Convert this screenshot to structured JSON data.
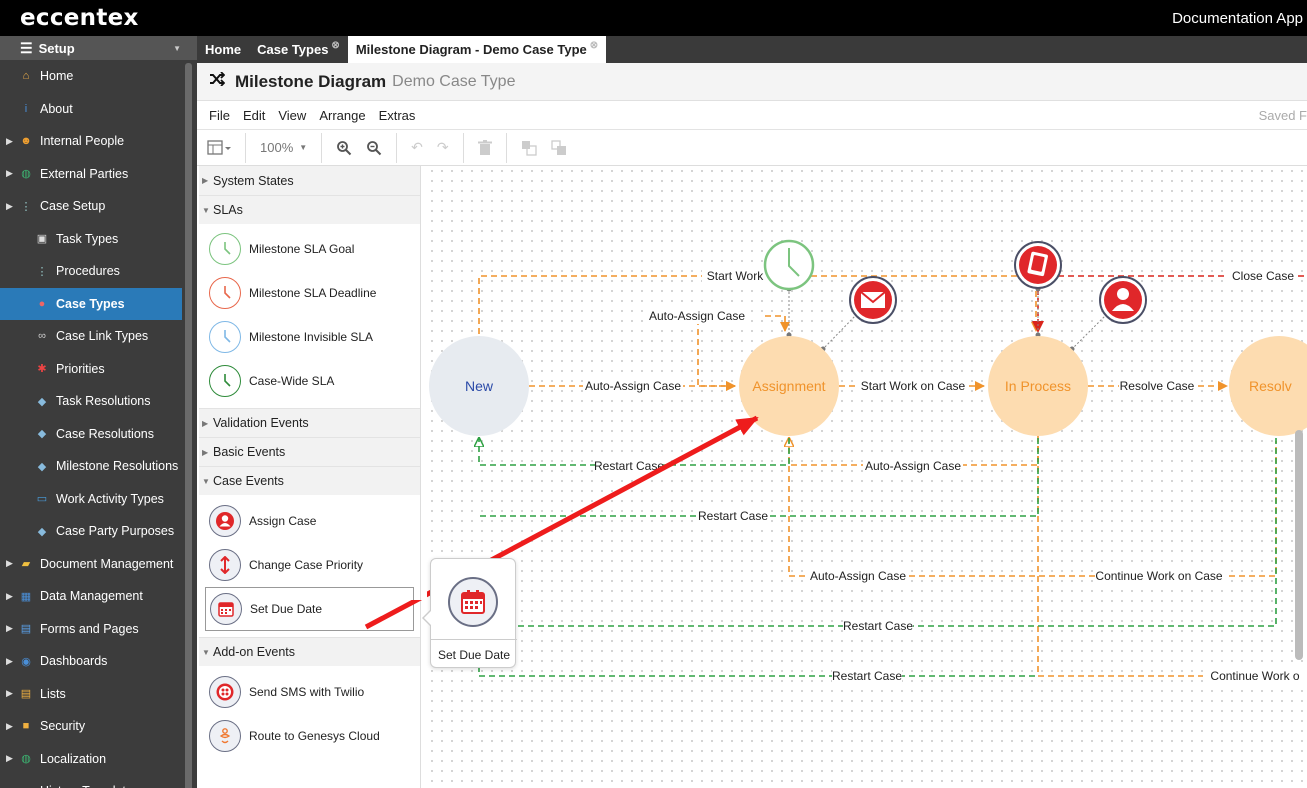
{
  "app": {
    "logo": "eccentex",
    "title": "Documentation App"
  },
  "sidebar": {
    "header": "Setup",
    "items": [
      {
        "label": "Home",
        "icon": "home-icon",
        "level": 0,
        "expandable": false
      },
      {
        "label": "About",
        "icon": "info-icon",
        "level": 0,
        "expandable": false
      },
      {
        "label": "Internal People",
        "icon": "people-icon",
        "level": 0,
        "expandable": true
      },
      {
        "label": "External Parties",
        "icon": "globe-icon",
        "level": 0,
        "expandable": true
      },
      {
        "label": "Case Setup",
        "icon": "case-setup-icon",
        "level": 0,
        "expandable": true
      },
      {
        "label": "Task Types",
        "icon": "box-icon",
        "level": 1,
        "expandable": false
      },
      {
        "label": "Procedures",
        "icon": "procedure-icon",
        "level": 1,
        "expandable": false
      },
      {
        "label": "Case Types",
        "icon": "case-types-icon",
        "level": 1,
        "expandable": false,
        "selected": true
      },
      {
        "label": "Case Link Types",
        "icon": "link-icon",
        "level": 1,
        "expandable": false
      },
      {
        "label": "Priorities",
        "icon": "asterisk-icon",
        "level": 1,
        "expandable": false
      },
      {
        "label": "Task Resolutions",
        "icon": "tag-icon",
        "level": 1,
        "expandable": false
      },
      {
        "label": "Case Resolutions",
        "icon": "tag-icon",
        "level": 1,
        "expandable": false
      },
      {
        "label": "Milestone Resolutions",
        "icon": "tag-icon",
        "level": 1,
        "expandable": false
      },
      {
        "label": "Work Activity Types",
        "icon": "monitor-icon",
        "level": 1,
        "expandable": false
      },
      {
        "label": "Case Party Purposes",
        "icon": "tag-icon",
        "level": 1,
        "expandable": false
      },
      {
        "label": "Document Management",
        "icon": "folder-icon",
        "level": 0,
        "expandable": true
      },
      {
        "label": "Data Management",
        "icon": "table-icon",
        "level": 0,
        "expandable": true
      },
      {
        "label": "Forms and Pages",
        "icon": "form-icon",
        "level": 0,
        "expandable": true
      },
      {
        "label": "Dashboards",
        "icon": "dashboard-icon",
        "level": 0,
        "expandable": true
      },
      {
        "label": "Lists",
        "icon": "list-icon",
        "level": 0,
        "expandable": true
      },
      {
        "label": "Security",
        "icon": "lock-icon",
        "level": 0,
        "expandable": true
      },
      {
        "label": "Localization",
        "icon": "globe-icon",
        "level": 0,
        "expandable": true
      },
      {
        "label": "History Templates",
        "icon": "history-icon",
        "level": 0,
        "expandable": true
      }
    ]
  },
  "tabs": [
    {
      "label": "Home",
      "closable": false,
      "active": false
    },
    {
      "label": "Case Types",
      "closable": true,
      "active": false
    },
    {
      "label": "Milestone Diagram - Demo Case Type",
      "closable": true,
      "active": true
    }
  ],
  "title": {
    "icon": "shuffle-icon",
    "main": "Milestone Diagram",
    "sub": "Demo Case Type"
  },
  "menu": {
    "items": [
      "File",
      "Edit",
      "View",
      "Arrange",
      "Extras"
    ],
    "status": "Saved F"
  },
  "toolbar": {
    "zoom": "100%"
  },
  "palette": {
    "sections": {
      "system_states": "System States",
      "slas": "SLAs",
      "validation_events": "Validation Events",
      "basic_events": "Basic Events",
      "case_events": "Case Events",
      "addon_events": "Add-on Events"
    },
    "sla_items": [
      {
        "label": "Milestone SLA Goal",
        "color": "#7cc47f"
      },
      {
        "label": "Milestone SLA Deadline",
        "color": "#e8674b"
      },
      {
        "label": "Milestone Invisible SLA",
        "color": "#7fb8e6"
      },
      {
        "label": "Case-Wide SLA",
        "color": "#2e8b3a"
      }
    ],
    "case_event_items": [
      {
        "label": "Assign Case",
        "icon": "person-icon"
      },
      {
        "label": "Change Case Priority",
        "icon": "priority-arrows-icon"
      },
      {
        "label": "Set Due Date",
        "icon": "calendar-icon",
        "highlighted": true
      }
    ],
    "addon_items": [
      {
        "label": "Send SMS with Twilio",
        "icon": "twilio-icon"
      },
      {
        "label": "Route to Genesys Cloud",
        "icon": "genesys-icon"
      }
    ]
  },
  "popup": {
    "label": "Set Due Date",
    "icon": "calendar-icon"
  },
  "diagram": {
    "nodes": {
      "new": "New",
      "assignment": "Assignment",
      "in_process": "In Process",
      "resolved": "Resolv"
    },
    "edges": {
      "start_work": "Start Work",
      "close_case": "Close Case",
      "auto_assign_top": "Auto-Assign Case",
      "auto_assign_new": "Auto-Assign Case",
      "start_work_on_case": "Start Work on Case",
      "resolve_case": "Resolve Case",
      "restart_1": "Restart Case",
      "auto_assign_return": "Auto-Assign Case",
      "restart_2": "Restart Case",
      "auto_assign_low": "Auto-Assign Case",
      "continue_work_1": "Continue Work on Case",
      "restart_3": "Restart Case",
      "restart_4": "Restart Case",
      "continue_work_2": "Continue Work o"
    },
    "colors": {
      "node_state": "#fddcb0",
      "node_new": "#e7ebf0",
      "orange": "#f0932b",
      "green": "#2ea043",
      "red": "#d9251c",
      "annotation_arrow": "#ee1c1c"
    }
  }
}
